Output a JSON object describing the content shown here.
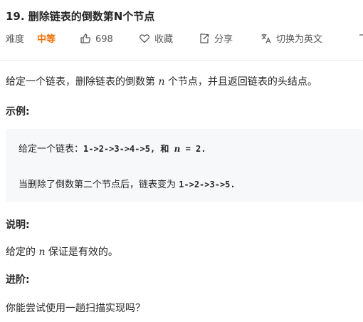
{
  "problem": {
    "title": "19. 删除链表的倒数第N个节点"
  },
  "meta": {
    "difficulty_label": "难度",
    "difficulty_value": "中等",
    "difficulty_color": "#ef6c00",
    "likes": "698",
    "like_icon": "thumbs-up-icon",
    "favorite_label": "收藏",
    "favorite_icon": "heart-icon",
    "share_label": "分享",
    "share_icon": "share-icon",
    "lang_label": "切换为英文",
    "lang_icon": "translate-icon"
  },
  "description": {
    "part1": "给定一个链表，删除链表的倒数第 ",
    "var": "n",
    "part2": " 个节点，并且返回链表的头结点。"
  },
  "example": {
    "heading": "示例:",
    "line1_prefix": "给定一个链表：",
    "line1_code": "1->2->3->4->5",
    "line1_mid": ", 和 ",
    "line1_var": "n",
    "line1_code2": " = 2",
    "line1_end": ".",
    "line2_prefix": "当删除了倒数第二个节点后，链表变为 ",
    "line2_code": "1->2->3->5",
    "line2_end": "."
  },
  "note": {
    "heading": "说明:",
    "part1": "给定的 ",
    "var": "n",
    "part2": " 保证是有效的。"
  },
  "advanced": {
    "heading": "进阶:",
    "text": "你能尝试使用一趟扫描实现吗？"
  }
}
